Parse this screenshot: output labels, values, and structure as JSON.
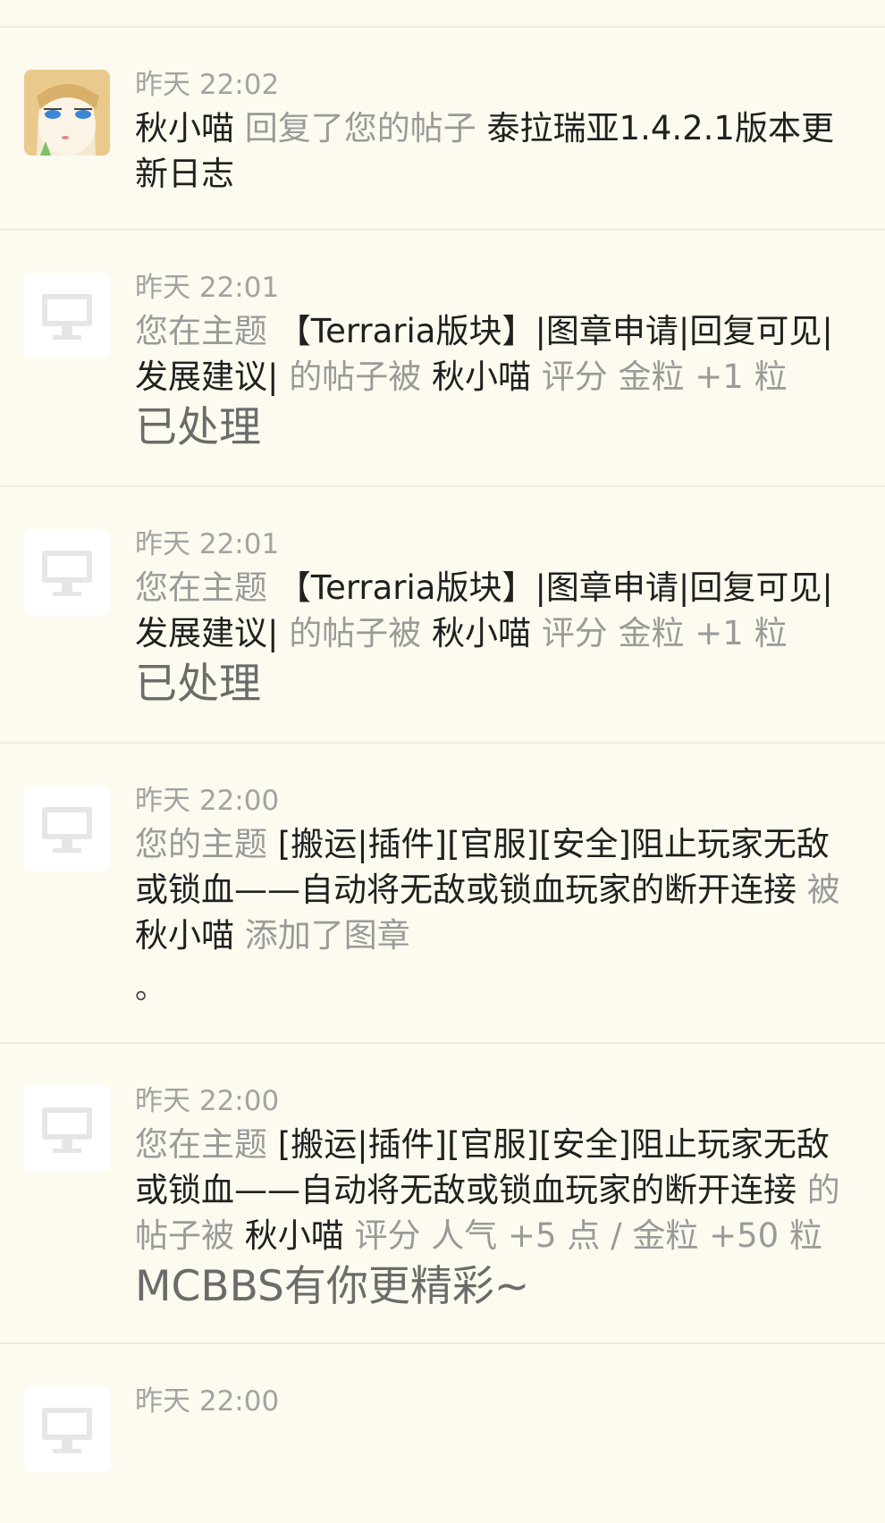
{
  "notifications": [
    {
      "time": "昨天 22:02",
      "user": "秋小喵",
      "action": "回复了您的帖子",
      "thread": "泰拉瑞亚1.4.2.1版本更新日志",
      "avatar_icon": "anime-girl-avatar"
    },
    {
      "time": "昨天 22:01",
      "prefix": "您在主题",
      "thread": "【Terraria版块】|图章申请|回复可见|发展建议|",
      "mid": "的帖子被",
      "user": "秋小喵",
      "rating": "评分 金粒 +1 粒",
      "extra": "已处理",
      "avatar_icon": "computer-monitor-icon"
    },
    {
      "time": "昨天 22:01",
      "prefix": "您在主题",
      "thread": "【Terraria版块】|图章申请|回复可见|发展建议|",
      "mid": "的帖子被",
      "user": "秋小喵",
      "rating": "评分 金粒 +1 粒",
      "extra": "已处理",
      "avatar_icon": "computer-monitor-icon"
    },
    {
      "time": "昨天 22:00",
      "prefix": "您的主题",
      "thread": "[搬运|插件][官服][安全]阻止玩家无敌或锁血——自动将无敌或锁血玩家的断开连接",
      "mid": "被",
      "user": "秋小喵",
      "action": "添加了图章",
      "extra": "。",
      "avatar_icon": "computer-monitor-icon"
    },
    {
      "time": "昨天 22:00",
      "prefix": "您在主题",
      "thread": "[搬运|插件][官服][安全]阻止玩家无敌或锁血——自动将无敌或锁血玩家的断开连接",
      "mid": "的帖子被",
      "user": "秋小喵",
      "rating": "评分 人气 +5 点 / 金粒 +50 粒",
      "extra": "MCBBS有你更精彩~",
      "avatar_icon": "computer-monitor-icon"
    },
    {
      "time": "昨天 22:00",
      "avatar_icon": "computer-monitor-icon"
    }
  ]
}
